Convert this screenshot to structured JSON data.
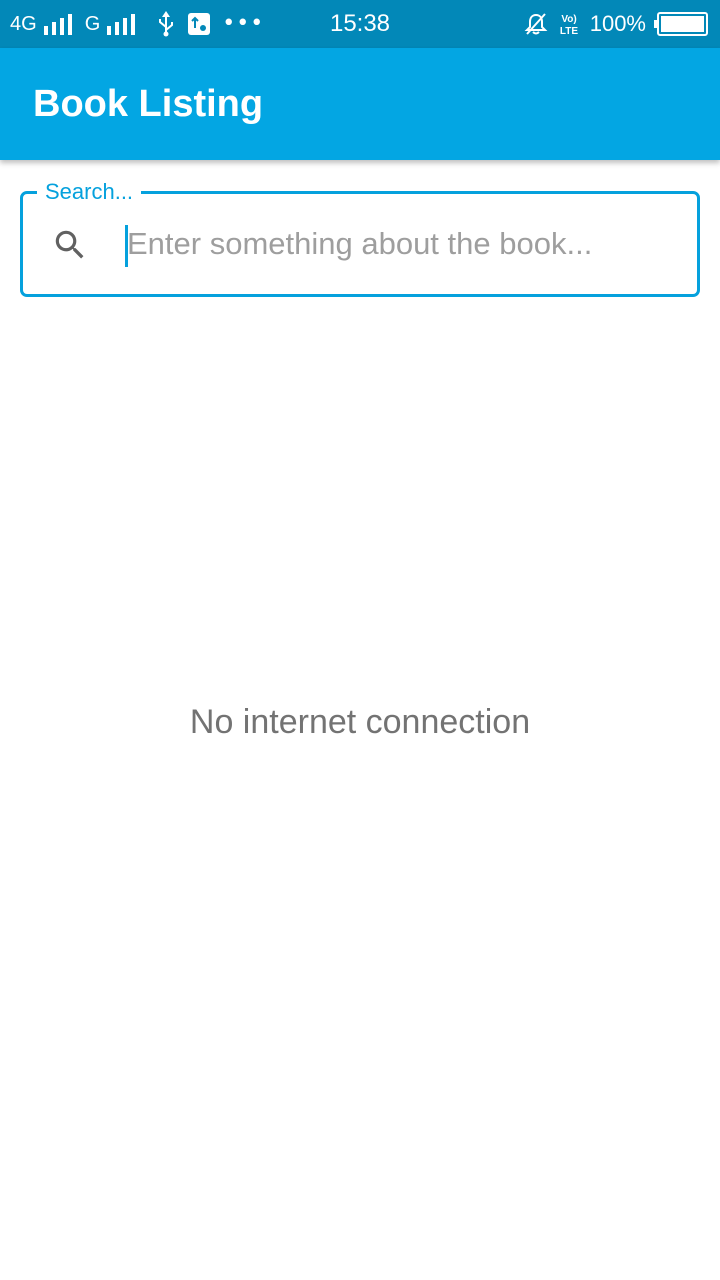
{
  "status_bar": {
    "network_1": "4G",
    "network_2": "G",
    "time": "15:38",
    "battery_percent": "100%",
    "volte_label_top": "Vo)",
    "volte_label_bottom": "LTE",
    "icons": [
      "signal-bars-icon",
      "usb-icon",
      "notification-app-icon",
      "more-dots-icon",
      "silent-bell-icon",
      "volte-icon",
      "battery-icon"
    ]
  },
  "app_bar": {
    "title": "Book Listing",
    "color": "#03a6e3"
  },
  "search": {
    "label": "Search...",
    "placeholder": "Enter something about the book...",
    "value": "",
    "icon": "search-icon",
    "accent_color": "#05a1dd"
  },
  "main": {
    "empty_message": "No internet connection"
  }
}
